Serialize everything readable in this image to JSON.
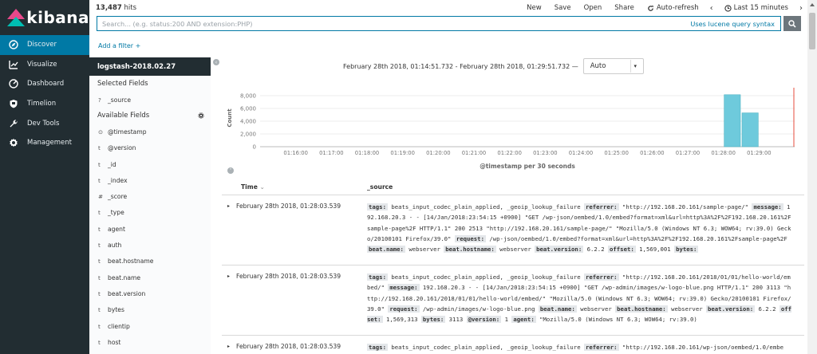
{
  "nav": {
    "logo": "kibana",
    "items": [
      {
        "label": "Discover",
        "icon": "compass-icon",
        "active": true
      },
      {
        "label": "Visualize",
        "icon": "chart-icon",
        "active": false
      },
      {
        "label": "Dashboard",
        "icon": "dashboard-icon",
        "active": false
      },
      {
        "label": "Timelion",
        "icon": "shield-icon",
        "active": false
      },
      {
        "label": "Dev Tools",
        "icon": "wrench-icon",
        "active": false
      },
      {
        "label": "Management",
        "icon": "gear-icon",
        "active": false
      }
    ]
  },
  "topbar": {
    "hits_count": "13,487",
    "hits_label": "hits",
    "new": "New",
    "save": "Save",
    "open": "Open",
    "share": "Share",
    "auto_refresh": "Auto-refresh",
    "time_range": "Last 15 minutes",
    "prev": "‹",
    "next": "›"
  },
  "query": {
    "placeholder": "Search... (e.g. status:200 AND extension:PHP)",
    "help": "Uses lucene query syntax"
  },
  "add_filter": "Add a filter +",
  "sidebar": {
    "index": "logstash-2018.02.27",
    "selected_title": "Selected Fields",
    "selected": [
      {
        "type": "?",
        "name": "_source"
      }
    ],
    "available_title": "Available Fields",
    "available": [
      {
        "type": "⊙",
        "name": "@timestamp"
      },
      {
        "type": "t",
        "name": "@version"
      },
      {
        "type": "t",
        "name": "_id"
      },
      {
        "type": "t",
        "name": "_index"
      },
      {
        "type": "#",
        "name": "_score"
      },
      {
        "type": "t",
        "name": "_type"
      },
      {
        "type": "t",
        "name": "agent"
      },
      {
        "type": "t",
        "name": "auth"
      },
      {
        "type": "t",
        "name": "beat.hostname"
      },
      {
        "type": "t",
        "name": "beat.name"
      },
      {
        "type": "t",
        "name": "beat.version"
      },
      {
        "type": "t",
        "name": "bytes"
      },
      {
        "type": "t",
        "name": "clientip"
      },
      {
        "type": "t",
        "name": "host"
      }
    ]
  },
  "chart_header": {
    "range": "February 28th 2018, 01:14:51.732 - February 28th 2018, 01:29:51.732 —",
    "interval": "Auto"
  },
  "chart_data": {
    "type": "bar",
    "title": "",
    "xlabel": "@timestamp per 30 seconds",
    "ylabel": "Count",
    "ylim": [
      0,
      9000
    ],
    "yticks": [
      "0",
      "2,000",
      "4,000",
      "6,000",
      "8,000"
    ],
    "xticks": [
      "01:16:00",
      "01:17:00",
      "01:18:00",
      "01:19:00",
      "01:20:00",
      "01:21:00",
      "01:22:00",
      "01:23:00",
      "01:24:00",
      "01:25:00",
      "01:26:00",
      "01:27:00",
      "01:28:00",
      "01:29:00"
    ],
    "bars": [
      {
        "x": "01:28:00",
        "value": 8150
      },
      {
        "x": "01:28:30",
        "value": 5300
      }
    ],
    "color": "#6ecadc"
  },
  "documents": {
    "time_header": "Time",
    "sort_icon": "⌄",
    "source_header": "_source",
    "rows": [
      {
        "time": "February 28th 2018, 01:28:03.539",
        "source": [
          {
            "k": "tags:"
          },
          {
            "v": " beats_input_codec_plain_applied, _geoip_lookup_failure "
          },
          {
            "k": "referrer:"
          },
          {
            "v": " \"http://192.168.20.161/sample-page/\" "
          },
          {
            "k": "message:"
          },
          {
            "v": " 192.168.20.3 - - [14/Jan/2018:23:54:15 +0900] \"GET /wp-json/oembed/1.0/embed?format=xml&url=http%3A%2F%2F192.168.20.161%2Fsample-page%2F HTTP/1.1\" 200 2513 \"http://192.168.20.161/sample-page/\" \"Mozilla/5.0 (Windows NT 6.3; WOW64; rv:39.0) Gecko/20100101 Firefox/39.0\" "
          },
          {
            "k": "request:"
          },
          {
            "v": " /wp-json/oembed/1.0/embed?format=xml&url=http%3A%2F%2F192.168.20.161%2Fsample-page%2F "
          },
          {
            "k": "beat.name:"
          },
          {
            "v": " webserver "
          },
          {
            "k": "beat.hostname:"
          },
          {
            "v": " webserver "
          },
          {
            "k": "beat.version:"
          },
          {
            "v": " 6.2.2 "
          },
          {
            "k": "offset:"
          },
          {
            "v": " 1,569,001 "
          },
          {
            "k": "bytes:"
          }
        ]
      },
      {
        "time": "February 28th 2018, 01:28:03.539",
        "source": [
          {
            "k": "tags:"
          },
          {
            "v": " beats_input_codec_plain_applied, _geoip_lookup_failure "
          },
          {
            "k": "referrer:"
          },
          {
            "v": " \"http://192.168.20.161/2018/01/01/hello-world/embed/\" "
          },
          {
            "k": "message:"
          },
          {
            "v": " 192.168.20.3 - - [14/Jan/2018:23:54:15 +0900] \"GET /wp-admin/images/w-logo-blue.png HTTP/1.1\" 200 3113 \"http://192.168.20.161/2018/01/01/hello-world/embed/\" \"Mozilla/5.0 (Windows NT 6.3; WOW64; rv:39.0) Gecko/20100101 Firefox/39.0\" "
          },
          {
            "k": "request:"
          },
          {
            "v": " /wp-admin/images/w-logo-blue.png "
          },
          {
            "k": "beat.name:"
          },
          {
            "v": " webserver "
          },
          {
            "k": "beat.hostname:"
          },
          {
            "v": " webserver "
          },
          {
            "k": "beat.version:"
          },
          {
            "v": " 6.2.2 "
          },
          {
            "k": "offset:"
          },
          {
            "v": " 1,569,313 "
          },
          {
            "k": "bytes:"
          },
          {
            "v": " 3113 "
          },
          {
            "k": "@version:"
          },
          {
            "v": " 1 "
          },
          {
            "k": "agent:"
          },
          {
            "v": " \"Mozilla/5.0 (Windows NT 6.3; WOW64; rv:39.0)"
          }
        ]
      },
      {
        "time": "February 28th 2018, 01:28:03.539",
        "source": [
          {
            "k": "tags:"
          },
          {
            "v": " beats_input_codec_plain_applied, _geoip_lookup_failure "
          },
          {
            "k": "referrer:"
          },
          {
            "v": " \"http://192.168.20.161/wp-json/oembed/1.0/embe"
          }
        ]
      }
    ]
  }
}
